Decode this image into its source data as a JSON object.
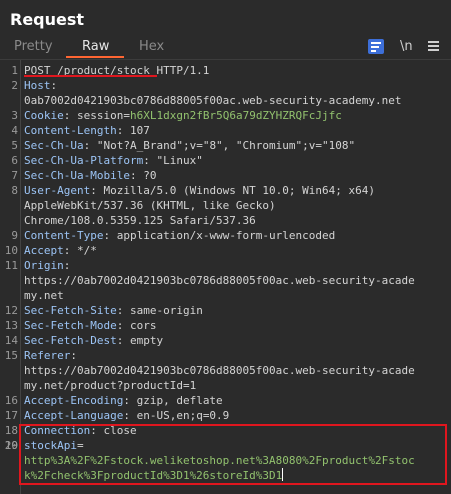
{
  "panel_title": "Request",
  "tabs": [
    {
      "label": "Pretty"
    },
    {
      "label": "Raw"
    },
    {
      "label": "Hex"
    }
  ],
  "toolbar": {
    "newline_label": "\\n"
  },
  "icons": {
    "wrap": "wrap-lines-icon",
    "menu": "hamburger-menu-icon"
  },
  "colors": {
    "accent": "#ff6633",
    "highlight": "#e0161e",
    "key": "#9cc4f5",
    "value_green": "#92c26e"
  },
  "lines": {
    "l1": "POST /product/stock HTTP/1.1",
    "l2_key": "Host",
    "l2_val": ":",
    "l2_cont": "0ab7002d0421903bc0786d88005f00ac.web-security-academy.net",
    "l3_key": "Cookie",
    "l3_sep": ": session=",
    "l3_val": "h6XL1dxgn2fBr5Q6a79dZYHZRQFcJjfc",
    "l4_key": "Content-Length",
    "l4_val": ": 107",
    "l5_key": "Sec-Ch-Ua",
    "l5_val": ": \"Not?A_Brand\";v=\"8\", \"Chromium\";v=\"108\"",
    "l6_key": "Sec-Ch-Ua-Platform",
    "l6_val": ": \"Linux\"",
    "l7_key": "Sec-Ch-Ua-Mobile",
    "l7_val": ": ?0",
    "l8_key": "User-Agent",
    "l8_val": ": Mozilla/5.0 (Windows NT 10.0; Win64; x64)",
    "l8_cont1": "AppleWebKit/537.36 (KHTML, like Gecko)",
    "l8_cont2": "Chrome/108.0.5359.125 Safari/537.36",
    "l9_key": "Content-Type",
    "l9_val": ": application/x-www-form-urlencoded",
    "l10_key": "Accept",
    "l10_val": ": */*",
    "l11_key": "Origin",
    "l11_val": ":",
    "l11_cont1": "https://0ab7002d0421903bc0786d88005f00ac.web-security-acade",
    "l11_cont2": "my.net",
    "l12_key": "Sec-Fetch-Site",
    "l12_val": ": same-origin",
    "l13_key": "Sec-Fetch-Mode",
    "l13_val": ": cors",
    "l14_key": "Sec-Fetch-Dest",
    "l14_val": ": empty",
    "l15_key": "Referer",
    "l15_val": ":",
    "l15_cont1": "https://0ab7002d0421903bc0786d88005f00ac.web-security-acade",
    "l15_cont2": "my.net/product?productId=1",
    "l16_key": "Accept-Encoding",
    "l16_val": ": gzip, deflate",
    "l17_key": "Accept-Language",
    "l17_val": ": en-US,en;q=0.9",
    "l18_key": "Connection",
    "l18_val": ": close",
    "l20_key": "stockApi",
    "l20_val": "=",
    "l20_cont1": "http%3A%2F%2Fstock.weliketoshop.net%3A8080%2Fproduct%2Fstoc",
    "l20_cont2": "k%2Fcheck%3FproductId%3D1%26storeId%3D1"
  },
  "line_numbers": [
    "1",
    "2",
    "3",
    "4",
    "5",
    "6",
    "7",
    "8",
    "9",
    "10",
    "11",
    "12",
    "13",
    "14",
    "15",
    "16",
    "17",
    "18",
    "19",
    "20"
  ]
}
